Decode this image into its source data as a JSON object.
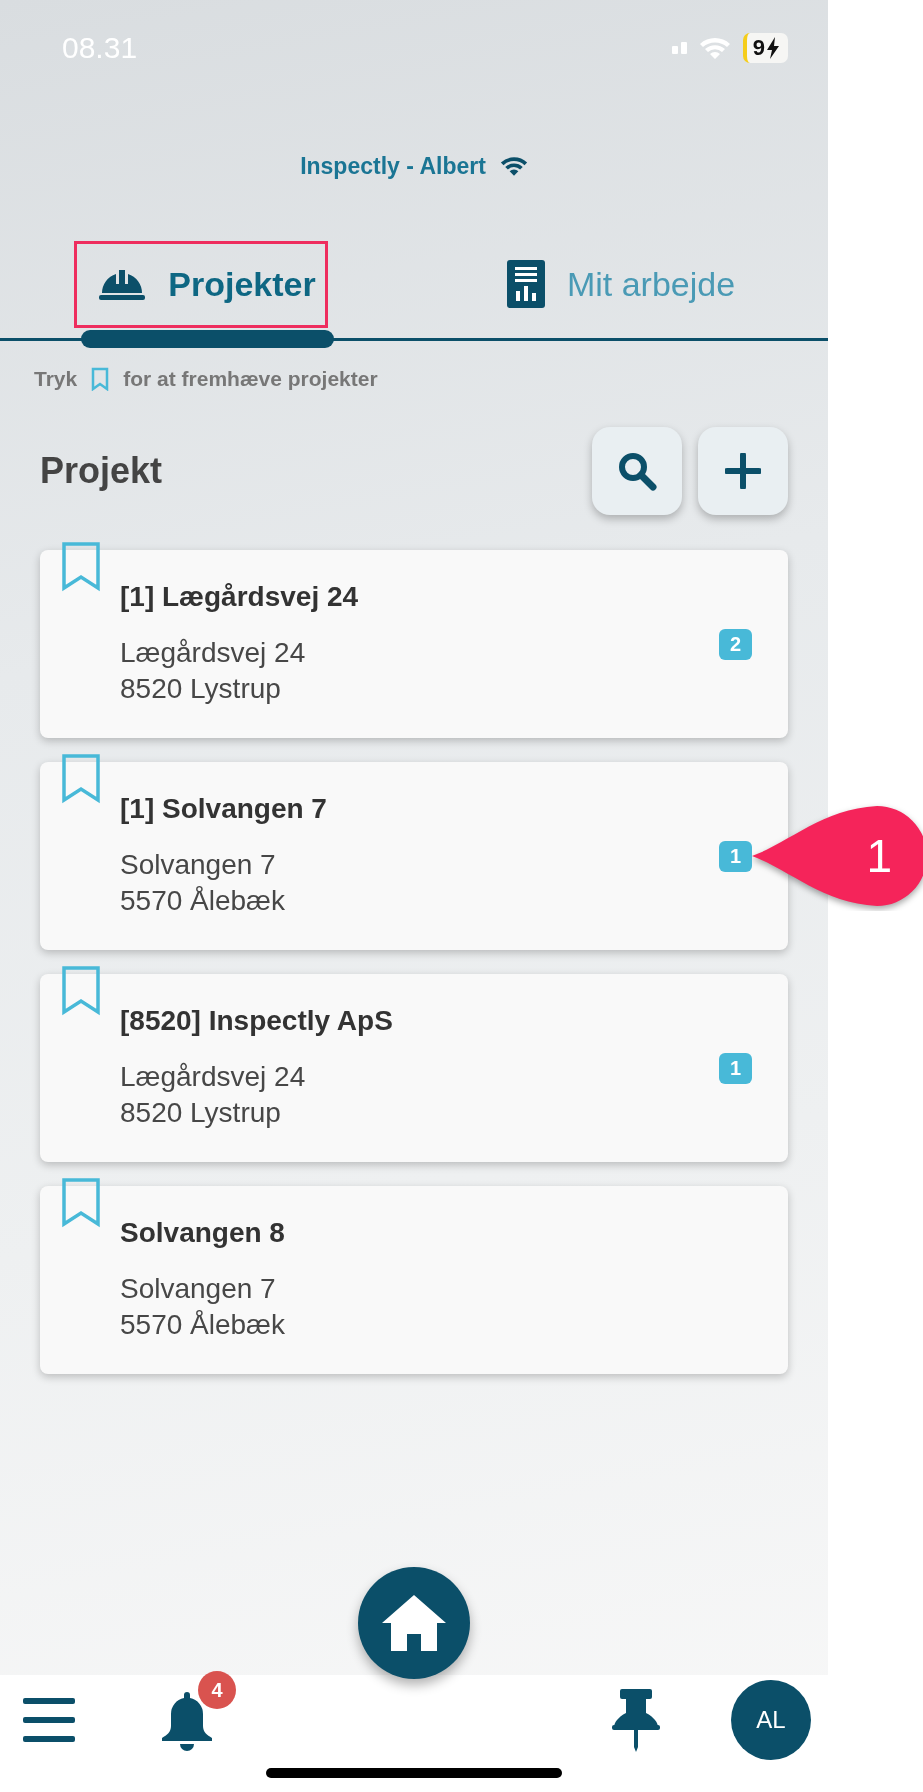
{
  "status_bar": {
    "time": "08.31",
    "battery": "9"
  },
  "connection": {
    "title": "Inspectly - Albert"
  },
  "tabs": [
    {
      "label": "Projekter",
      "selected": true,
      "highlighted": true
    },
    {
      "label": "Mit arbejde",
      "selected": false,
      "highlighted": false
    }
  ],
  "hint": {
    "before": "Tryk",
    "after": "for at fremhæve projekter"
  },
  "section": {
    "title": "Projekt",
    "actions": [
      {
        "kind": "search"
      },
      {
        "kind": "add"
      }
    ]
  },
  "projects": [
    {
      "title": "[1] Lægårdsvej 24",
      "street": "Lægårdsvej 24",
      "city": "8520 Lystrup",
      "count": "2",
      "bookmarked": false
    },
    {
      "title": "[1] Solvangen 7",
      "street": "Solvangen 7",
      "city": "5570 Ålebæk",
      "count": "1",
      "bookmarked": false,
      "callout": "1"
    },
    {
      "title": "[8520] Inspectly ApS",
      "street": "Lægårdsvej 24",
      "city": "8520 Lystrup",
      "count": "1",
      "bookmarked": false
    },
    {
      "title": "Solvangen 8",
      "street": "Solvangen 7",
      "city": "5570 Ålebæk",
      "bookmarked": false
    }
  ],
  "bottom_nav": [
    {
      "kind": "menu"
    },
    {
      "kind": "notifications",
      "badge": "4"
    },
    {
      "kind": "home"
    },
    {
      "kind": "pin"
    },
    {
      "kind": "avatar",
      "initials": "AL"
    }
  ]
}
